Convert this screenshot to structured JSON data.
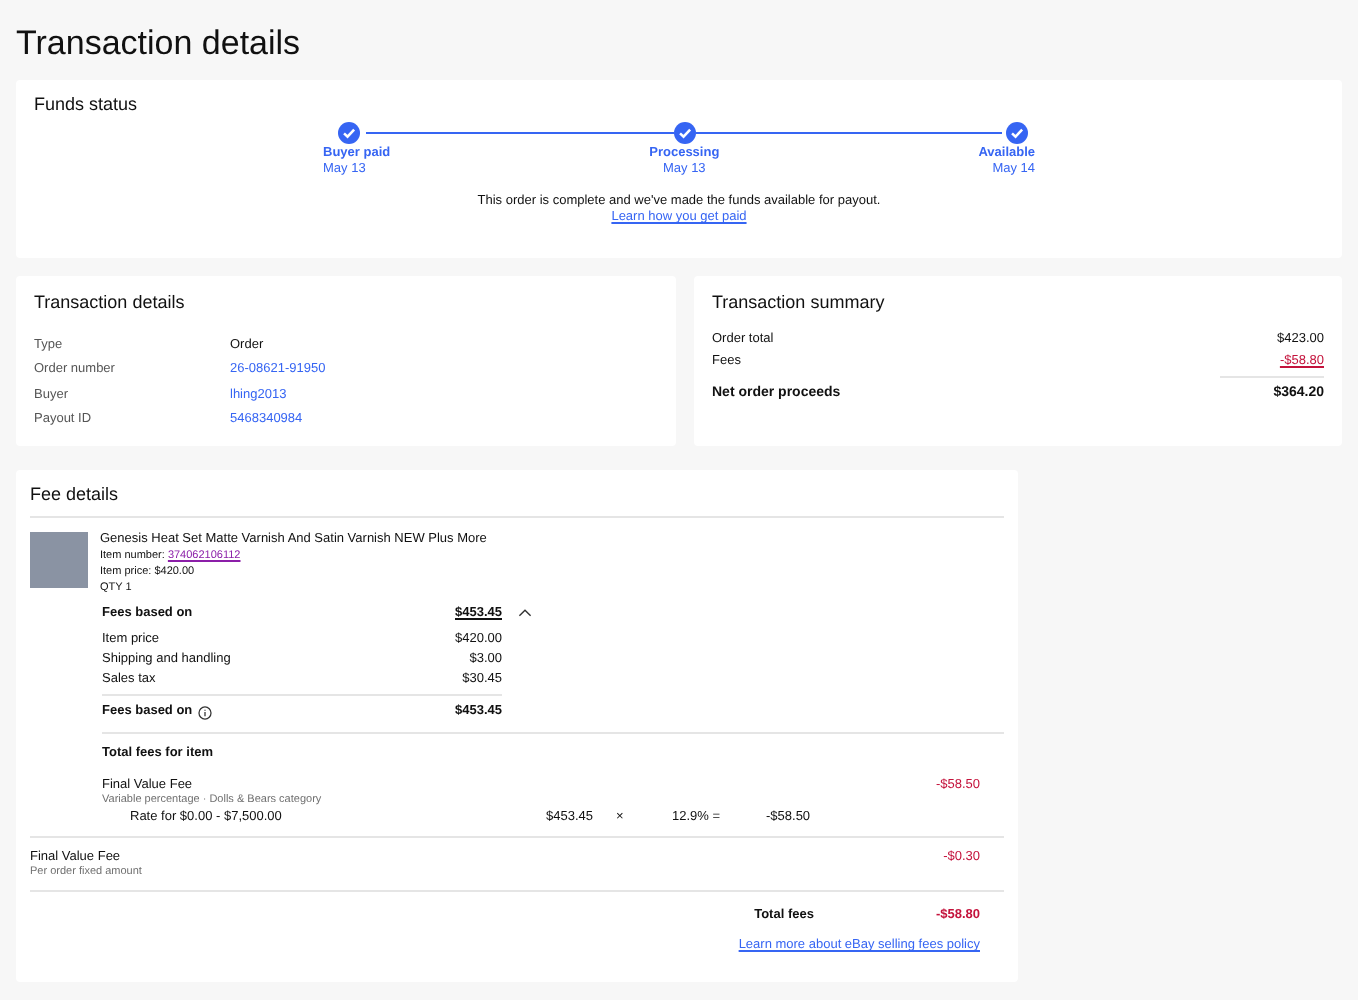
{
  "page_title": "Transaction details",
  "funds_status": {
    "title": "Funds status",
    "steps": [
      {
        "label": "Buyer paid",
        "date": "May 13",
        "done": true
      },
      {
        "label": "Processing",
        "date": "May 13",
        "done": true
      },
      {
        "label": "Available",
        "date": "May 14",
        "done": true
      }
    ],
    "message": "This order is complete and we've made the funds available for payout.",
    "link": "Learn how you get paid"
  },
  "transaction_details": {
    "title": "Transaction details",
    "rows": [
      {
        "label": "Type",
        "value": "Order",
        "kind": "text"
      },
      {
        "label": "Order number",
        "value": "26-08621-91950",
        "kind": "link"
      },
      {
        "label": "Buyer",
        "value": "lhing2013",
        "kind": "link"
      },
      {
        "label": "Payout ID",
        "value": "5468340984",
        "kind": "link"
      }
    ]
  },
  "transaction_summary": {
    "title": "Transaction summary",
    "rows": [
      {
        "label": "Order total",
        "value": "$423.00",
        "kind": "text"
      },
      {
        "label": "Fees",
        "value": "-$58.80",
        "kind": "fee"
      }
    ],
    "net_label": "Net order proceeds",
    "net_value": "$364.20"
  },
  "fee_details": {
    "title": "Fee details",
    "item": {
      "title": "Genesis Heat Set Matte Varnish And Satin Varnish NEW Plus More",
      "number_label": "Item number:",
      "number": "374062106112",
      "price": "Item price: $420.00",
      "qty": "QTY 1"
    },
    "fees_based_on": {
      "label": "Fees based on",
      "value": "$453.45",
      "expanded": true,
      "rows": [
        {
          "label": "Item price",
          "value": "$420.00"
        },
        {
          "label": "Shipping and handling",
          "value": "$3.00"
        },
        {
          "label": "Sales tax",
          "value": "$30.45"
        }
      ],
      "total_label": "Fees based on",
      "total_value": "$453.45"
    },
    "total_fees_for_item": "Total fees for item",
    "item_fee": {
      "name": "Final Value Fee",
      "note": "Variable percentage · Dolls & Bears category",
      "amount": "-$58.50",
      "rate": {
        "label": "Rate for $0.00 - $7,500.00",
        "base": "$453.45",
        "times": "×",
        "percent": "12.9% =",
        "result": "-$58.50"
      }
    },
    "order_fee": {
      "name": "Final Value Fee",
      "note": "Per order fixed amount",
      "amount": "-$0.30"
    },
    "total_label": "Total fees",
    "total_value": "-$58.80",
    "policy_link": "Learn more about eBay selling fees policy"
  }
}
